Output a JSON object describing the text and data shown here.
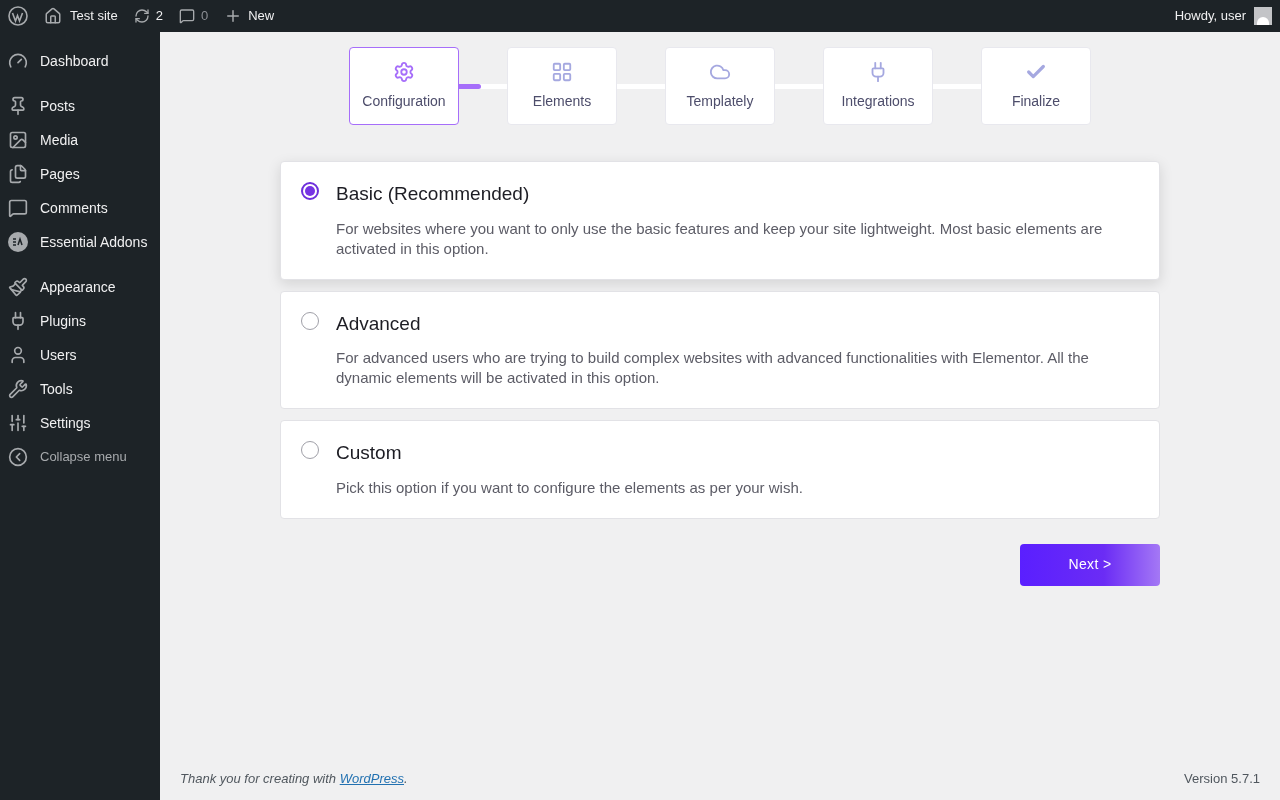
{
  "admin_bar": {
    "site": "Test site",
    "updates": "2",
    "comments": "0",
    "new": "New",
    "greeting": "Howdy, user"
  },
  "sidebar": {
    "groups": [
      [
        {
          "label": "Dashboard"
        }
      ],
      [
        {
          "label": "Posts"
        },
        {
          "label": "Media"
        },
        {
          "label": "Pages"
        },
        {
          "label": "Comments"
        },
        {
          "label": "Essential Addons"
        }
      ],
      [
        {
          "label": "Appearance"
        },
        {
          "label": "Plugins"
        },
        {
          "label": "Users"
        },
        {
          "label": "Tools"
        },
        {
          "label": "Settings"
        }
      ]
    ],
    "collapse": "Collapse menu"
  },
  "steps": [
    {
      "label": "Configuration",
      "selected": true
    },
    {
      "label": "Elements",
      "selected": false
    },
    {
      "label": "Templately",
      "selected": false
    },
    {
      "label": "Integrations",
      "selected": false
    },
    {
      "label": "Finalize",
      "selected": false
    }
  ],
  "options": [
    {
      "title": "Basic (Recommended)",
      "description": "For websites where you want to only use the basic features and keep your site lightweight. Most basic elements are activated in this option.",
      "selected": true
    },
    {
      "title": "Advanced",
      "description": "For advanced users who are trying to build complex websites with advanced functionalities with Elementor. All the dynamic elements will be activated in this option.",
      "selected": false
    },
    {
      "title": "Custom",
      "description": "Pick this option if you want to configure the elements as per your wish.",
      "selected": false
    }
  ],
  "next_button": "Next >",
  "footer": {
    "thanks": "Thank you for creating with",
    "link": "WordPress",
    "after": ".",
    "version": "Version 5.7.1"
  }
}
